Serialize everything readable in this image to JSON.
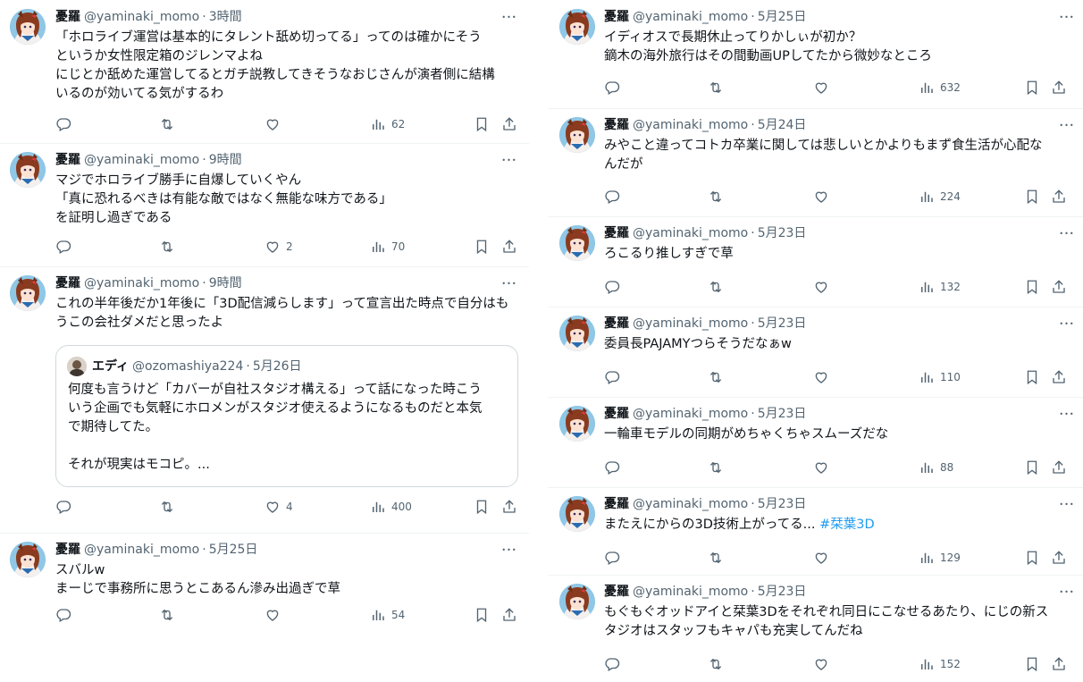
{
  "author": {
    "name": "憂羅",
    "handle": "@yaminaki_momo"
  },
  "left_tweets": [
    {
      "time": "3時間",
      "text": "「ホロライブ運営は基本的にタレント舐め切ってる」ってのは確かにそう\nというか女性限定箱のジレンマよね\nにじとか舐めた運営してるとガチ説教してきそうなおじさんが演者側に結構\nいるのが効いてる気がするわ",
      "replies": "",
      "retweets": "",
      "likes": "",
      "views": "62"
    },
    {
      "time": "9時間",
      "text": "マジでホロライブ勝手に自爆していくやん\n「真に恐れるべきは有能な敵ではなく無能な味方である」\nを証明し過ぎである",
      "replies": "",
      "retweets": "",
      "likes": "2",
      "views": "70"
    },
    {
      "time": "9時間",
      "text": "これの半年後だか1年後に「3D配信減らします」って宣言出た時点で自分はも\nうこの会社ダメだと思ったよ",
      "replies": "",
      "retweets": "",
      "likes": "4",
      "views": "400",
      "quote": {
        "name": "エディ",
        "handle": "@ozomashiya224",
        "time": "5月26日",
        "text": "何度も言うけど「カバーが自社スタジオ構える」って話になった時こう\nいう企画でも気軽にホロメンがスタジオ使えるようになるものだと本気\nで期待してた。\n\nそれが現実はモコピ。..."
      }
    },
    {
      "time": "5月25日",
      "text": "スバルw\nまーじで事務所に思うとこあるん滲み出過ぎで草",
      "replies": "",
      "retweets": "",
      "likes": "",
      "views": "54"
    }
  ],
  "right_tweets": [
    {
      "time": "5月25日",
      "text": "イディオスで長期休止ってりかしぃが初か？\n鏑木の海外旅行はその間動画UPしてたから微妙なところ",
      "replies": "",
      "retweets": "",
      "likes": "",
      "views": "632"
    },
    {
      "time": "5月24日",
      "text": "みやこと違ってコトカ卒業に関しては悲しいとかよりもまず食生活が心配な\nんだが",
      "replies": "",
      "retweets": "",
      "likes": "",
      "views": "224"
    },
    {
      "time": "5月23日",
      "text": "ろこるり推しすぎで草",
      "replies": "",
      "retweets": "",
      "likes": "",
      "views": "132"
    },
    {
      "time": "5月23日",
      "text": "委員長PAJAMYつらそうだなぁw",
      "replies": "",
      "retweets": "",
      "likes": "",
      "views": "110"
    },
    {
      "time": "5月23日",
      "text": "一輪車モデルの同期がめちゃくちゃスムーズだな",
      "replies": "",
      "retweets": "",
      "likes": "",
      "views": "88"
    },
    {
      "time": "5月23日",
      "text": "またえにからの3D技術上がってる...",
      "hashtag": "#栞葉3D",
      "replies": "",
      "retweets": "",
      "likes": "",
      "views": "129"
    },
    {
      "time": "5月23日",
      "text": "もぐもぐオッドアイと栞葉3Dをそれぞれ同日にこなせるあたり、にじの新ス\nタジオはスタッフもキャパも充実してんだね",
      "replies": "",
      "retweets": "",
      "likes": "",
      "views": "152"
    }
  ],
  "separator": "·",
  "icons": {
    "reply": "reply-icon",
    "retweet": "retweet-icon",
    "like": "heart-icon",
    "views": "views-icon",
    "bookmark": "bookmark-icon",
    "share": "share-icon",
    "more": "more-icon"
  },
  "colors": {
    "text": "#0f1419",
    "secondary": "#536471",
    "hashtag": "#1d9bf0",
    "border": "#eff3f4"
  }
}
